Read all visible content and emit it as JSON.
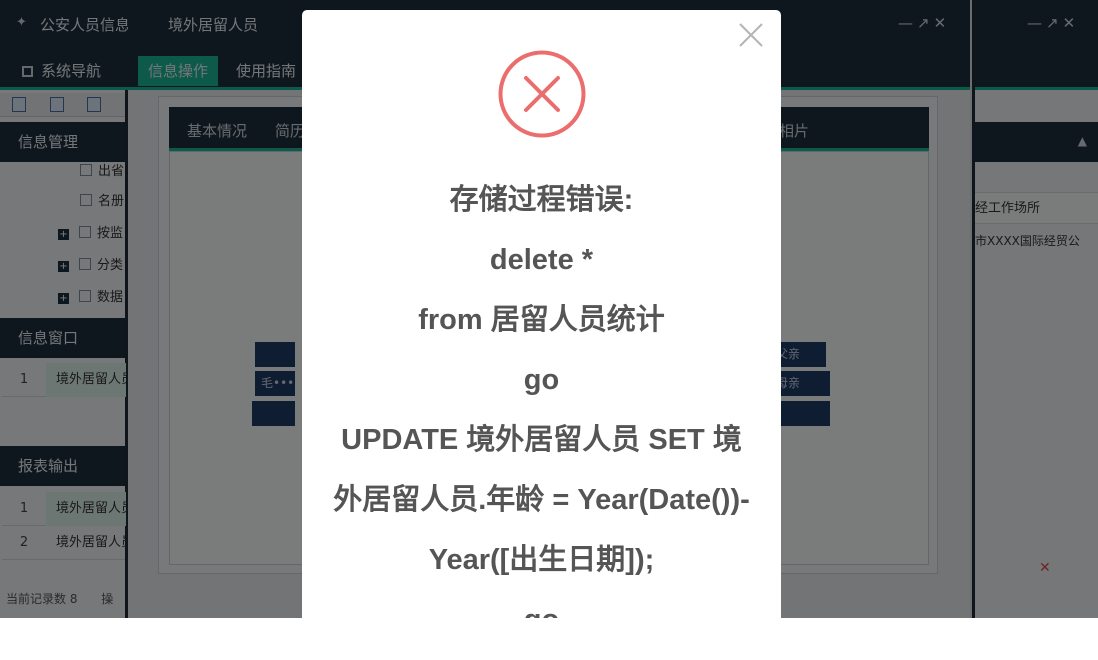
{
  "left_window": {
    "title": "公安人员信息",
    "tab": "系统导航",
    "section_info": "信息管理",
    "tree": [
      "出省",
      "名册",
      "按监",
      "分类",
      "数据"
    ],
    "section_window": "信息窗口",
    "window_rows": [
      {
        "num": "1",
        "text": "境外居留人员"
      }
    ],
    "section_report": "报表输出",
    "report_rows": [
      {
        "num": "1",
        "text": "境外居留人员"
      },
      {
        "num": "2",
        "text": "境外居留人员"
      }
    ],
    "status": "当前记录数 8",
    "status_tail": "操"
  },
  "mid_window": {
    "title": "境外居留人员",
    "tabs": [
      "信息操作",
      "使用指南"
    ],
    "subtabs": [
      "基本情况",
      "简历",
      "相片"
    ],
    "bars": [
      "",
      "毛•••",
      "",
      "父亲",
      "母亲",
      ""
    ]
  },
  "right_window": {
    "column": "经工作场所",
    "cell": "市XXXX国际经贸公"
  },
  "dialog": {
    "message_lines": [
      "存储过程错误:",
      "delete *",
      "from 居留人员统计",
      "go",
      "UPDATE 境外居留人员 SET 境",
      "外居留人员.年龄 = Year(Date())-",
      "Year([出生日期]);",
      "go"
    ],
    "icon": "error-circle-icon",
    "icon_color": "#ec6d6d"
  },
  "colors": {
    "dark": "#1f2e3d",
    "accent": "#1bb394",
    "bar": "#1f3a66"
  }
}
